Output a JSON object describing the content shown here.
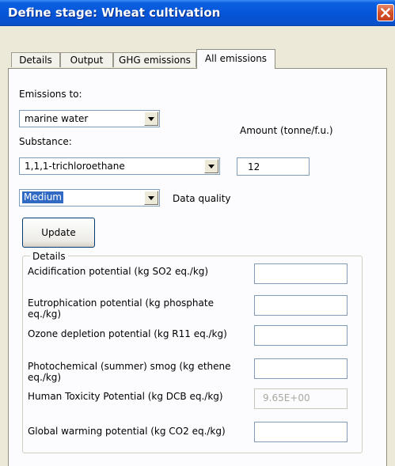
{
  "window": {
    "title": "Define stage: Wheat cultivation"
  },
  "tabs": [
    {
      "label": "Details",
      "active": false
    },
    {
      "label": "Output",
      "active": false
    },
    {
      "label": "GHG emissions",
      "active": false
    },
    {
      "label": "All emissions",
      "active": true
    }
  ],
  "form": {
    "emissions_to_label": "Emissions to:",
    "emissions_to_value": "marine water",
    "substance_label": "Substance:",
    "substance_value": "1,1,1-trichloroethane",
    "amount_label": "Amount (tonne/f.u.)",
    "amount_value": "12",
    "data_quality_value": "Medium",
    "data_quality_label": "Data quality",
    "update_button": "Update"
  },
  "details": {
    "legend": "Details",
    "fields": [
      {
        "label": "Acidification potential (kg SO2 eq./kg)",
        "value": "",
        "enabled": true
      },
      {
        "label": "Eutrophication potential (kg phosphate eq./kg)",
        "value": "",
        "enabled": true
      },
      {
        "label": "Ozone depletion potential (kg R11 eq./kg)",
        "value": "",
        "enabled": true
      },
      {
        "label": "Photochemical (summer) smog (kg ethene eq./kg)",
        "value": "",
        "enabled": true
      },
      {
        "label": "Human Toxicity Potential (kg DCB eq./kg)",
        "value": "9.65E+00",
        "enabled": false
      },
      {
        "label": "Global warming potential (kg CO2 eq./kg)",
        "value": "",
        "enabled": true
      }
    ]
  },
  "icons": {
    "close": "close-icon",
    "dropdown": "chevron-down-icon"
  },
  "colors": {
    "titlebar": "#0654d6",
    "close_button": "#d4502b",
    "selection": "#316ac5",
    "dialog_bg": "#ece9d8"
  }
}
